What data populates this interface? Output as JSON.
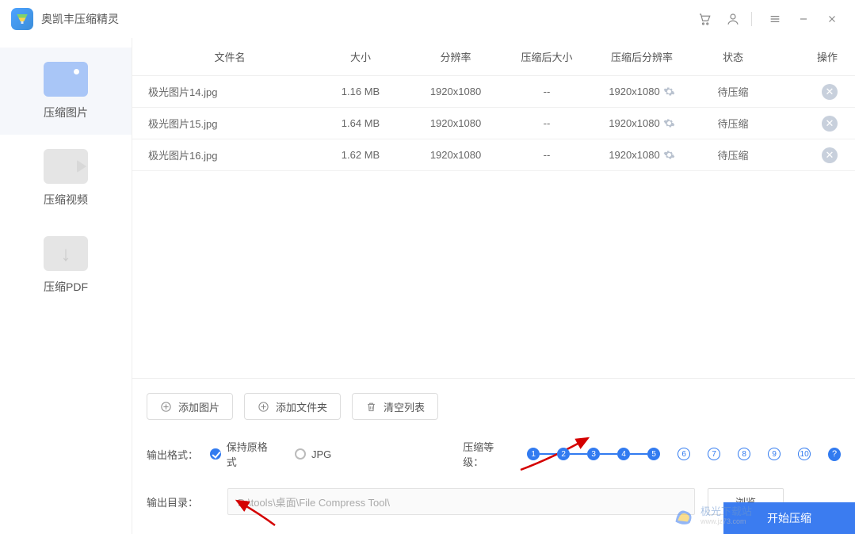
{
  "app": {
    "title": "奥凯丰压缩精灵"
  },
  "sidebar": {
    "items": [
      {
        "label": "压缩图片"
      },
      {
        "label": "压缩视频"
      },
      {
        "label": "压缩PDF"
      }
    ]
  },
  "table": {
    "headers": {
      "name": "文件名",
      "size": "大小",
      "resolution": "分辨率",
      "compressed_size": "压缩后大小",
      "compressed_resolution": "压缩后分辨率",
      "status": "状态",
      "operation": "操作"
    },
    "rows": [
      {
        "name": "极光图片14.jpg",
        "size": "1.16 MB",
        "resolution": "1920x1080",
        "csize": "--",
        "cres": "1920x1080",
        "status": "待压缩"
      },
      {
        "name": "极光图片15.jpg",
        "size": "1.64 MB",
        "resolution": "1920x1080",
        "csize": "--",
        "cres": "1920x1080",
        "status": "待压缩"
      },
      {
        "name": "极光图片16.jpg",
        "size": "1.62 MB",
        "resolution": "1920x1080",
        "csize": "--",
        "cres": "1920x1080",
        "status": "待压缩"
      }
    ]
  },
  "buttons": {
    "add_image": "添加图片",
    "add_folder": "添加文件夹",
    "clear_list": "清空列表",
    "browse": "浏览",
    "start": "开始压缩"
  },
  "settings": {
    "output_format_label": "输出格式：",
    "format_keep": "保持原格式",
    "format_jpg": "JPG",
    "compression_level_label": "压缩等级：",
    "level_selected": 5,
    "level_max": 10,
    "output_dir_label": "输出目录：",
    "output_dir_value": "D:\\tools\\桌面\\File Compress Tool\\"
  },
  "watermark": {
    "text": "极光下载站",
    "sub": "www.jz73.com"
  },
  "colors": {
    "primary": "#327bf0"
  }
}
